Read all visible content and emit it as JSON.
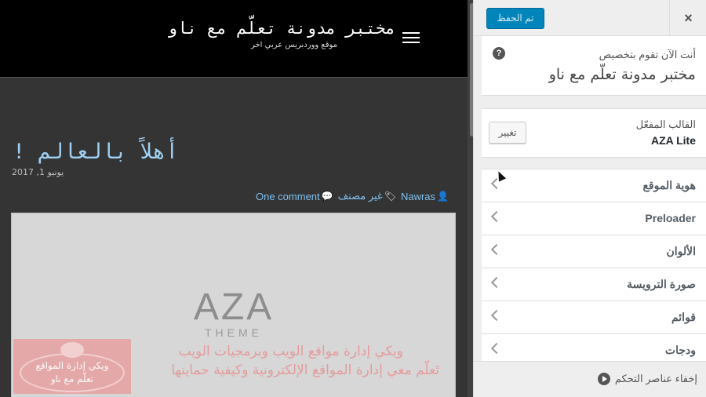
{
  "preview": {
    "site_title": "مختبر مدونة تعلّم مع ناو",
    "site_tagline": "موقع ووردبريس عربي اخر",
    "post": {
      "title": "أهلاً بالعالم !",
      "date": "يونيو 1, 2017",
      "author": "Nawras",
      "category": "غير مصنف",
      "comments": "One comment"
    },
    "featured_image": {
      "logo_text": "AZA",
      "logo_subtext": "THEME",
      "watermark_box_text": "ويكي إدارة المواقع\nتعلّم مع ناو",
      "watermark_line1": "ويكي إدارة مواقع الويب وبرمجيات الويب",
      "watermark_line2": "تَعلّم معي إدارة المواقع الإلكترونية وكيفية حمايتها"
    }
  },
  "panel": {
    "save_label": "تم الحفظ",
    "close_icon": "×",
    "help_icon": "?",
    "info_pre": "أنت الآن تقوم بتخصيص",
    "info_title": "مختبر مدونة تعلّم مع ناو",
    "theme_label": "القالب المفعّل",
    "theme_name": "AZA Lite",
    "change_label": "تغيير",
    "sections": [
      {
        "label": "هوية الموقع"
      },
      {
        "label": "Preloader"
      },
      {
        "label": "الألوان"
      },
      {
        "label": "صورة الترويسة"
      },
      {
        "label": "قوائم"
      },
      {
        "label": "ودجات"
      }
    ],
    "collapse_label": "إخفاء عناصر التحكم"
  },
  "colors": {
    "accent": "#0085ba",
    "link": "#7fc0ef",
    "header_bg": "#000000",
    "preview_bg": "#343434"
  }
}
